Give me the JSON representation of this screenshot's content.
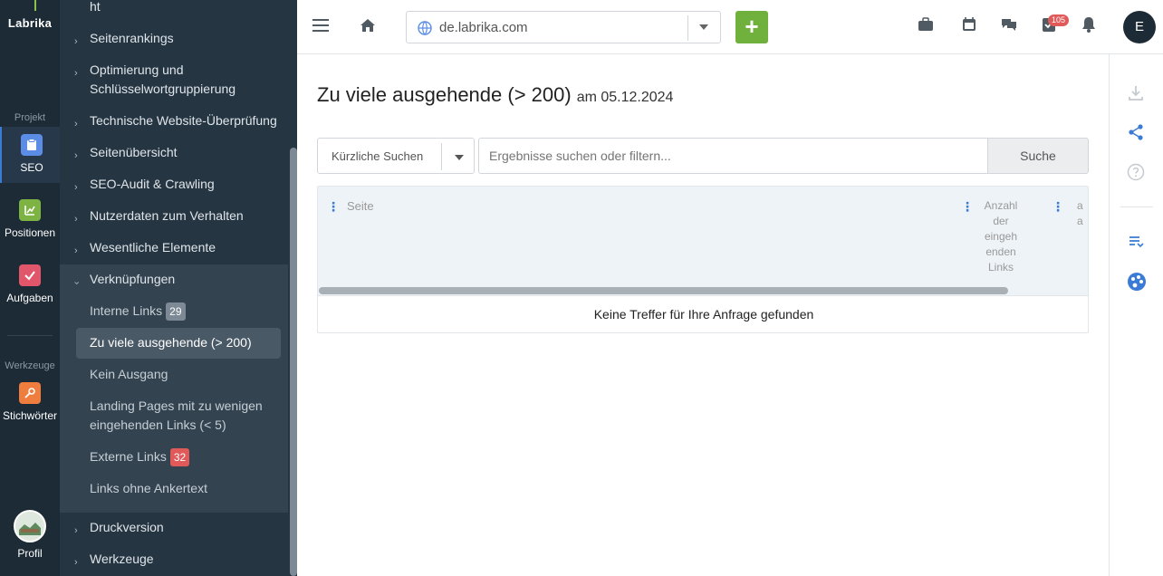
{
  "rail": {
    "logo": "Labrika",
    "section_project": "Projekt",
    "section_tools": "Werkzeuge",
    "items": [
      {
        "label": "SEO",
        "icon": "clipboard-icon",
        "color": "#5b8de6"
      },
      {
        "label": "Positionen",
        "icon": "chart-icon",
        "color": "#7cb342"
      },
      {
        "label": "Aufgaben",
        "icon": "check-icon",
        "color": "#e2566b"
      },
      {
        "label": "Stichwörter",
        "icon": "key-icon",
        "color": "#ef7d3e"
      }
    ],
    "profile_label": "Profil"
  },
  "sidebar": {
    "top_partial": "ht",
    "items": [
      {
        "label": "Seitenrankings"
      },
      {
        "label": "Optimierung und Schlüsselwortgruppierung"
      },
      {
        "label": "Technische Website-Überprüfung"
      },
      {
        "label": "Seitenübersicht"
      },
      {
        "label": "SEO-Audit & Crawling"
      },
      {
        "label": "Nutzerdaten zum Verhalten"
      },
      {
        "label": "Wesentliche Elemente"
      },
      {
        "label": "Verknüpfungen"
      }
    ],
    "sub_items": [
      {
        "label": "Interne Links",
        "badge": "29",
        "badge_color": "#7d8a95"
      },
      {
        "label": "Zu viele ausgehende (> 200)"
      },
      {
        "label": "Kein Ausgang"
      },
      {
        "label": "Landing Pages mit zu wenigen eingehenden Links (< 5)"
      },
      {
        "label": "Externe Links",
        "badge": "32",
        "badge_color": "#e05a5a"
      },
      {
        "label": "Links ohne Ankertext"
      }
    ],
    "bottom_items": [
      {
        "label": "Druckversion"
      },
      {
        "label": "Werkzeuge"
      }
    ]
  },
  "topbar": {
    "domain": "de.labrika.com",
    "add_label": "+",
    "notification_count": "105",
    "user_initial": "E"
  },
  "main": {
    "title": "Zu viele ausgehende (> 200)",
    "date": "am 05.12.2024",
    "recent_searches": "Kürzliche Suchen",
    "search_placeholder": "Ergebnisse suchen oder filtern...",
    "search_button": "Suche",
    "table": {
      "col_page": "Seite",
      "col_incoming": "Anzahl der eingeh enden Links",
      "col_cut": "a\na",
      "empty_message": "Keine Treffer für Ihre Anfrage gefunden"
    }
  }
}
